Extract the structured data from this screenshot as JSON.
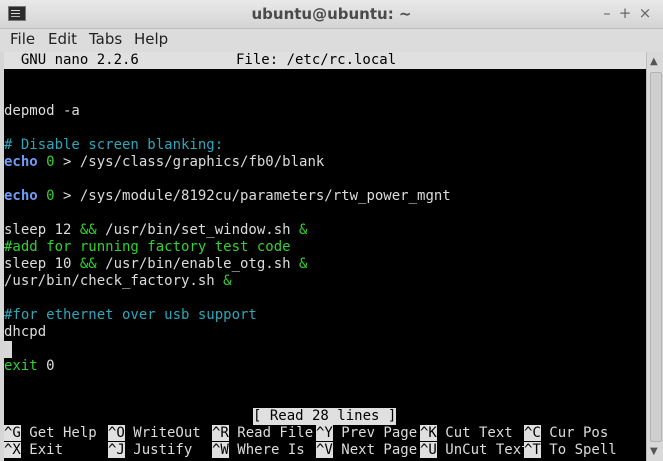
{
  "window": {
    "title": "ubuntu@ubuntu: ~",
    "icon": "terminal-icon",
    "controls": {
      "minimize": "–",
      "maximize": "+",
      "close": "×"
    }
  },
  "menubar": {
    "items": [
      "File",
      "Edit",
      "Tabs",
      "Help"
    ]
  },
  "nano": {
    "header_left": "  GNU nano 2.2.6",
    "header_mid": "File: /etc/rc.local",
    "lines": {
      "l1": "depmod -a",
      "l2": "# Disable screen blanking:",
      "l3_kw": "echo",
      "l3_num": " 0 ",
      "l3_rest": "> /sys/class/graphics/fb0/blank",
      "l4_kw": "echo",
      "l4_num": " 0 ",
      "l4_rest": "> /sys/module/8192cu/parameters/rtw_power_mgnt",
      "l5_a": "sleep 12 ",
      "l5_op": "&&",
      "l5_b": " /usr/bin/set_window.sh ",
      "l5_amp": "&",
      "l6": "#add for running factory test code",
      "l7_a": "sleep 10 ",
      "l7_op": "&&",
      "l7_b": " /usr/bin/enable_otg.sh ",
      "l7_amp": "&",
      "l8_a": "/usr/bin/check_factory.sh ",
      "l8_amp": "&",
      "l9": "#for ethernet over usb support",
      "l10": "dhcpd",
      "l11_kw": "exit",
      "l11_num": " 0"
    },
    "status": "[ Read 28 lines ]",
    "shortcuts": [
      {
        "key": "^G",
        "label": " Get Help"
      },
      {
        "key": "^O",
        "label": " WriteOut"
      },
      {
        "key": "^R",
        "label": " Read File"
      },
      {
        "key": "^Y",
        "label": " Prev Page"
      },
      {
        "key": "^K",
        "label": " Cut Text"
      },
      {
        "key": "^C",
        "label": " Cur Pos"
      },
      {
        "key": "^X",
        "label": " Exit"
      },
      {
        "key": "^J",
        "label": " Justify"
      },
      {
        "key": "^W",
        "label": " Where Is"
      },
      {
        "key": "^V",
        "label": " Next Page"
      },
      {
        "key": "^U",
        "label": " UnCut Text"
      },
      {
        "key": "^T",
        "label": " To Spell"
      }
    ]
  }
}
